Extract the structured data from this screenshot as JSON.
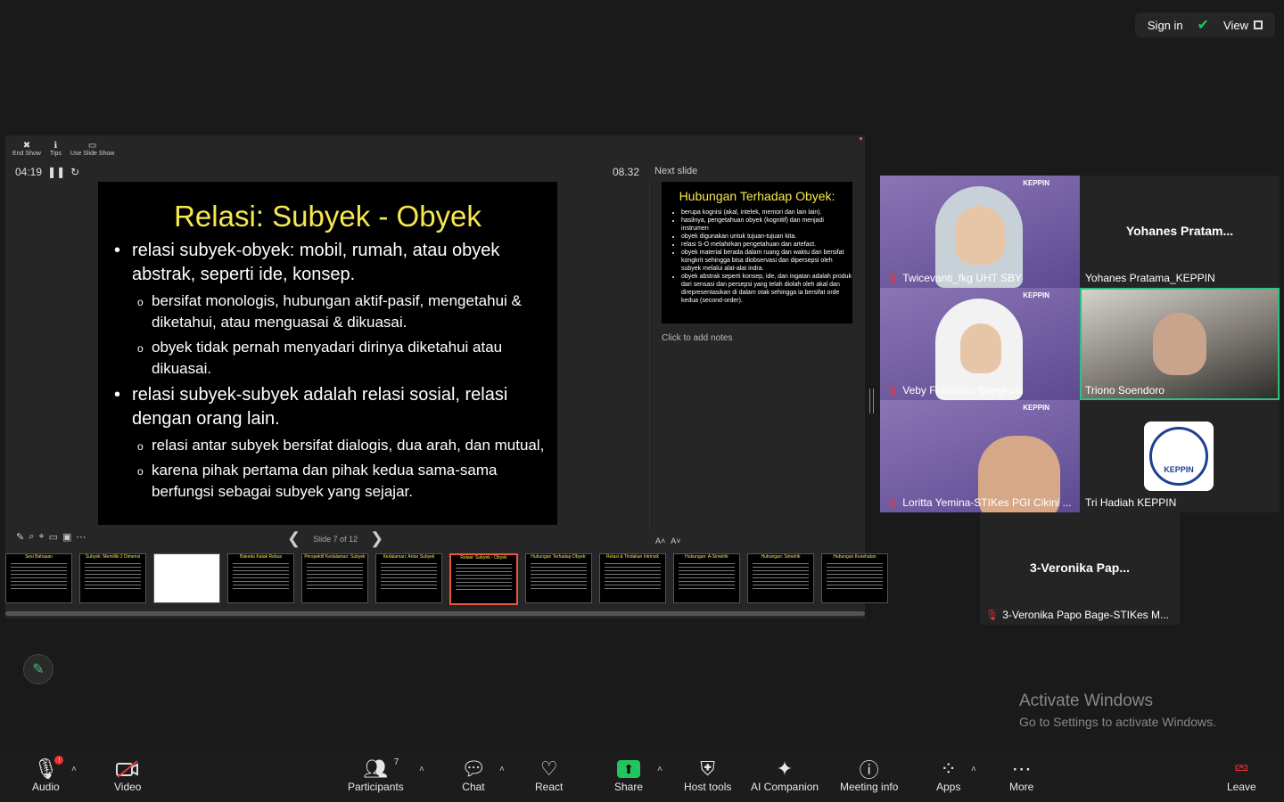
{
  "topbar": {
    "sign_in": "Sign in",
    "view": "View"
  },
  "presenter": {
    "toolbar": [
      "End Show",
      "Tips",
      "Use Slide Show"
    ],
    "timer": "04:19",
    "clock": "08.32",
    "next_slide_label": "Next slide",
    "notes_placeholder": "Click to add notes",
    "slide_counter": "Slide 7 of 12",
    "current_slide": {
      "title": "Relasi: Subyek - Obyek",
      "b1": "relasi subyek-obyek: mobil, rumah, atau obyek abstrak, seperti ide, konsep.",
      "b1a": "bersifat monologis, hubungan aktif-pasif, mengetahui & diketahui, atau menguasai & dikuasai.",
      "b1b": "obyek tidak pernah menyadari dirinya diketahui atau dikuasai.",
      "b2": "relasi subyek-subyek adalah relasi sosial, relasi dengan orang lain.",
      "b2a": "relasi antar subyek bersifat dialogis, dua arah, dan mutual,",
      "b2b": "karena pihak pertama dan pihak kedua sama-sama berfungsi sebagai subyek yang sejajar."
    },
    "next_slide": {
      "title": "Hubungan Terhadap Obyek:",
      "bullets": [
        "berupa kognisi (akal, intelek, memori dan lain lain).",
        "hasilnya, pengetahuan obyek (kognitif) dan menjadi instrumen",
        "obyek digunakan untuk tujuan-tujuan kita.",
        "relasi S-O melahirkan pengetahuan dan artefact.",
        "obyek material berada dalam ruang dan waktu dan bersifat kongkrit sehingga bisa diobservasi dan dipersepsi oleh subyek melalui alat-alat indra.",
        "obyek abstrak seperti konsep, ide, dan ingatan adalah produk dari sensasi dan persepsi yang telah diolah oleh akal dan direpresentasikan di dalam otak sehingga ia bersifat orde kedua (second-order)."
      ]
    },
    "filmstrip": [
      {
        "n": "1",
        "title": "Sesi Bahasan"
      },
      {
        "n": "2",
        "title": "Subyek: Memiliki 2 Dimensi"
      },
      {
        "n": "3",
        "title": ""
      },
      {
        "n": "4",
        "title": "Bakeda Katak Rebus"
      },
      {
        "n": "5",
        "title": "Perspektif Kedalaman: Subyek"
      },
      {
        "n": "6",
        "title": "Kedalaman: Antar Subyek"
      },
      {
        "n": "7",
        "title": "Relasi: Subyek - Obyek"
      },
      {
        "n": "8",
        "title": "Hubungan Terhadap Obyek:"
      },
      {
        "n": "9",
        "title": "Relasi & Tindakan Intrinsik"
      },
      {
        "n": "10",
        "title": "Hubungan: A-Simetrik"
      },
      {
        "n": "11",
        "title": "Hubungan: Simetrik"
      },
      {
        "n": "12",
        "title": "Hubungan Kesehatan"
      }
    ]
  },
  "participants": [
    {
      "name": "Twicevanti_fkg UHT SBY",
      "muted": true
    },
    {
      "name": "Yohanes Pratama_KEPPIN",
      "display": "Yohanes  Pratam..."
    },
    {
      "name": "Veby Fransisca Bengkulu",
      "muted": true
    },
    {
      "name": "Triono Soendoro"
    },
    {
      "name": "Loritta Yemina-STIKes PGI Cikini ...",
      "muted": true
    },
    {
      "name": "Tri Hadiah KEPPIN",
      "logo_text": "KEPPIN"
    },
    {
      "name": "3-Veronika Papo Bage-STIKes M...",
      "display": "3-Veronika  Pap...",
      "muted": true
    }
  ],
  "tile_logo_text": "KEPPIN",
  "watermark": {
    "line1": "Activate Windows",
    "line2": "Go to Settings to activate Windows."
  },
  "controls": {
    "audio": "Audio",
    "video": "Video",
    "participants": "Participants",
    "participants_count": "7",
    "chat": "Chat",
    "react": "React",
    "share": "Share",
    "host_tools": "Host tools",
    "ai_companion": "AI Companion",
    "meeting_info": "Meeting info",
    "apps": "Apps",
    "more": "More",
    "leave": "Leave"
  },
  "colors": {
    "accent_green": "#2ec27e",
    "slide_title": "#f7e84e",
    "active_slide": "#e9573f",
    "muted": "#e33333"
  }
}
